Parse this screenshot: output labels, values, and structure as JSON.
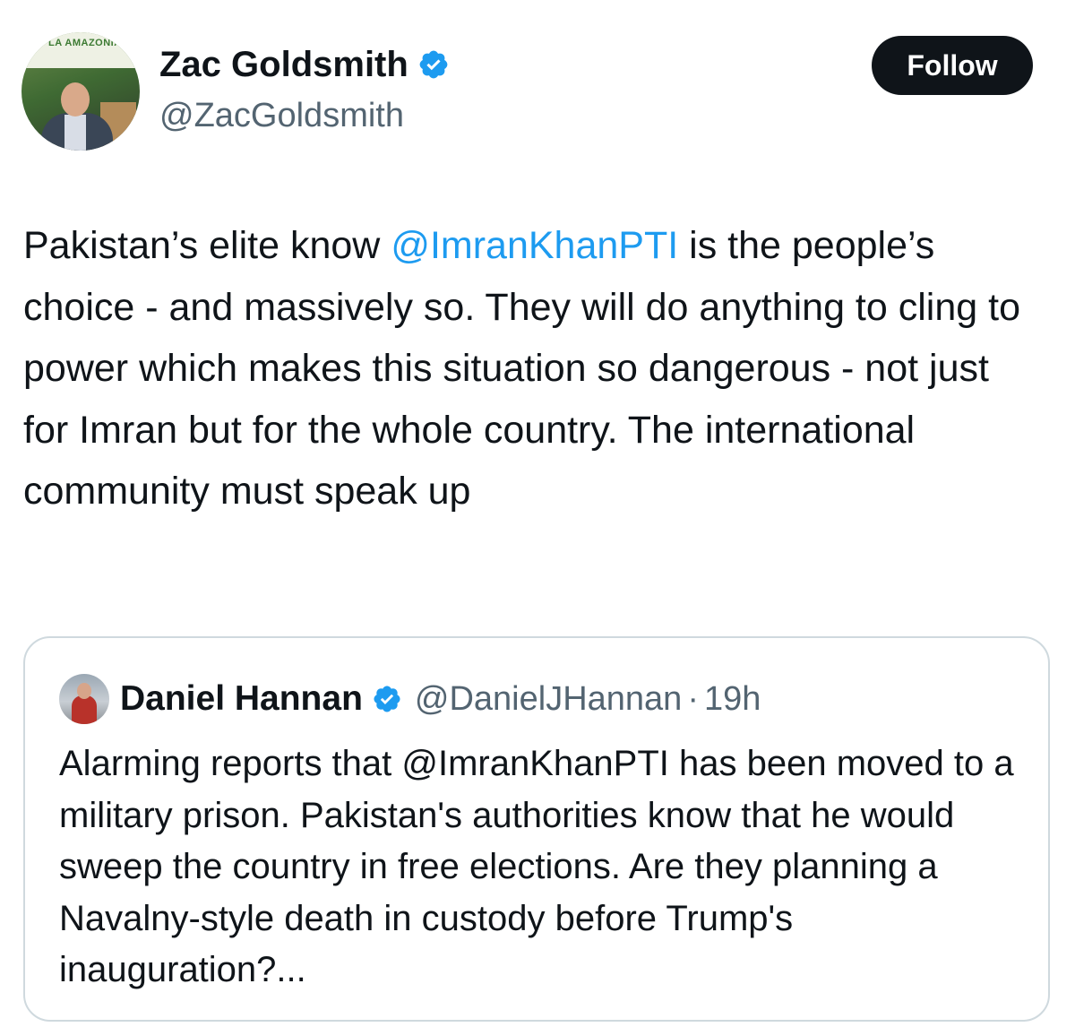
{
  "tweet": {
    "author": {
      "display_name": "Zac Goldsmith",
      "handle": "@ZacGoldsmith",
      "avatar_banner_text": "LA AMAZONIA"
    },
    "follow_label": "Follow",
    "text_parts": {
      "before": "Pakistan’s elite know ",
      "mention": "@ImranKhanPTI",
      "after": " is the people’s choice - and massively so. They will do anything to cling to power which makes this situation so dangerous - not just for Imran but for the whole country. The international community must speak up"
    },
    "quote": {
      "display_name": "Daniel Hannan",
      "handle": "@DanielJHannan",
      "separator": "·",
      "time": "19h",
      "text": "Alarming reports that @ImranKhanPTI has been moved to a military prison. Pakistan's authorities know that he would sweep the country in free elections. Are they planning a Navalny-style death in custody before Trump's inauguration?..."
    }
  },
  "icons": {
    "verified": "verified-badge-icon"
  },
  "colors": {
    "text": "#0f1419",
    "secondary": "#536471",
    "link": "#1d9bf0",
    "verified": "#1d9bf0",
    "button_bg": "#0f1419",
    "border": "#cfd9de"
  }
}
